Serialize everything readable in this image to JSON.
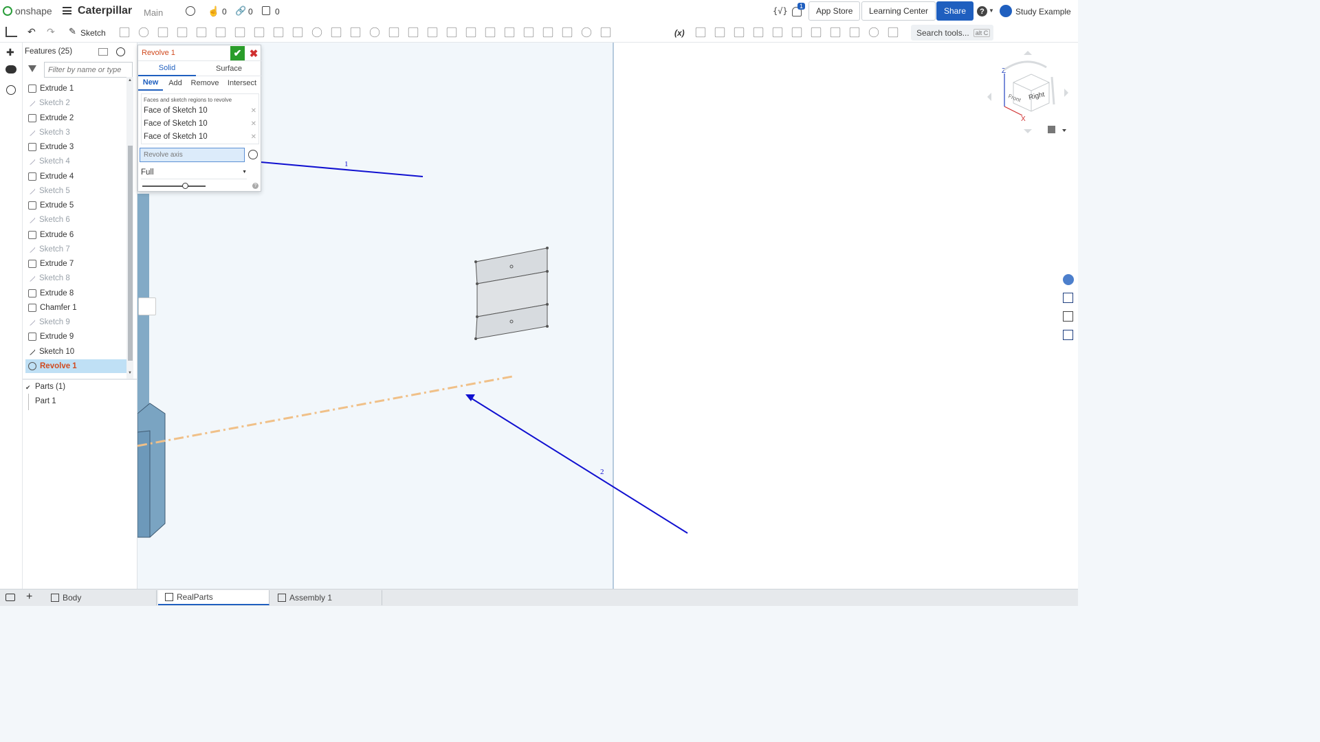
{
  "app": {
    "brand": "onshape",
    "doc_title": "Caterpillar",
    "branch": "Main",
    "likes": "0",
    "links": "0",
    "copies": "0"
  },
  "header": {
    "app_store": "App Store",
    "learning": "Learning Center",
    "share": "Share",
    "user": "Study Example",
    "notif_count": "1",
    "vars_label": "{√}"
  },
  "toolbar": {
    "sketch_label": "Sketch",
    "search_placeholder": "Search tools...",
    "search_hint": "alt C",
    "var_label": "(x)"
  },
  "features": {
    "title": "Features (25)",
    "filter_placeholder": "Filter by name or type",
    "items": [
      {
        "label": "Extrude 1",
        "kind": "extrude"
      },
      {
        "label": "Sketch 2",
        "kind": "sketch"
      },
      {
        "label": "Extrude 2",
        "kind": "extrude"
      },
      {
        "label": "Sketch 3",
        "kind": "sketch"
      },
      {
        "label": "Extrude 3",
        "kind": "extrude"
      },
      {
        "label": "Sketch 4",
        "kind": "sketch"
      },
      {
        "label": "Extrude 4",
        "kind": "extrude"
      },
      {
        "label": "Sketch 5",
        "kind": "sketch"
      },
      {
        "label": "Extrude 5",
        "kind": "extrude"
      },
      {
        "label": "Sketch 6",
        "kind": "sketch"
      },
      {
        "label": "Extrude 6",
        "kind": "extrude"
      },
      {
        "label": "Sketch 7",
        "kind": "sketch"
      },
      {
        "label": "Extrude 7",
        "kind": "extrude"
      },
      {
        "label": "Sketch 8",
        "kind": "sketch"
      },
      {
        "label": "Extrude 8",
        "kind": "extrude"
      },
      {
        "label": "Chamfer 1",
        "kind": "extrude"
      },
      {
        "label": "Sketch 9",
        "kind": "sketch"
      },
      {
        "label": "Extrude 9",
        "kind": "extrude"
      },
      {
        "label": "Sketch 10",
        "kind": "sketch-active"
      },
      {
        "label": "Revolve 1",
        "kind": "selected"
      }
    ],
    "parts_header": "Parts (1)",
    "parts": [
      "Part 1"
    ]
  },
  "dialog": {
    "title": "Revolve 1",
    "type_tabs": [
      "Solid",
      "Surface"
    ],
    "op_tabs": [
      "New",
      "Add",
      "Remove",
      "Intersect"
    ],
    "faces_label": "Faces and sketch regions to revolve",
    "faces": [
      "Face of Sketch 10",
      "Face of Sketch 10",
      "Face of Sketch 10"
    ],
    "axis_placeholder": "Revolve axis",
    "revolve_type": "Full",
    "slider_value": 0.45
  },
  "annotations": {
    "arrow1": "1",
    "arrow2": "2"
  },
  "viewcube": {
    "front": "Front",
    "right": "Right",
    "z": "Z",
    "x": "X"
  },
  "tabs": [
    "Body",
    "RealParts",
    "Assembly 1"
  ],
  "colors": {
    "accent": "#1f5fbf",
    "selected": "#d04a1f",
    "axis": "#f0c088",
    "annotation": "#1010d0",
    "confirm": "#2a9d2a"
  }
}
